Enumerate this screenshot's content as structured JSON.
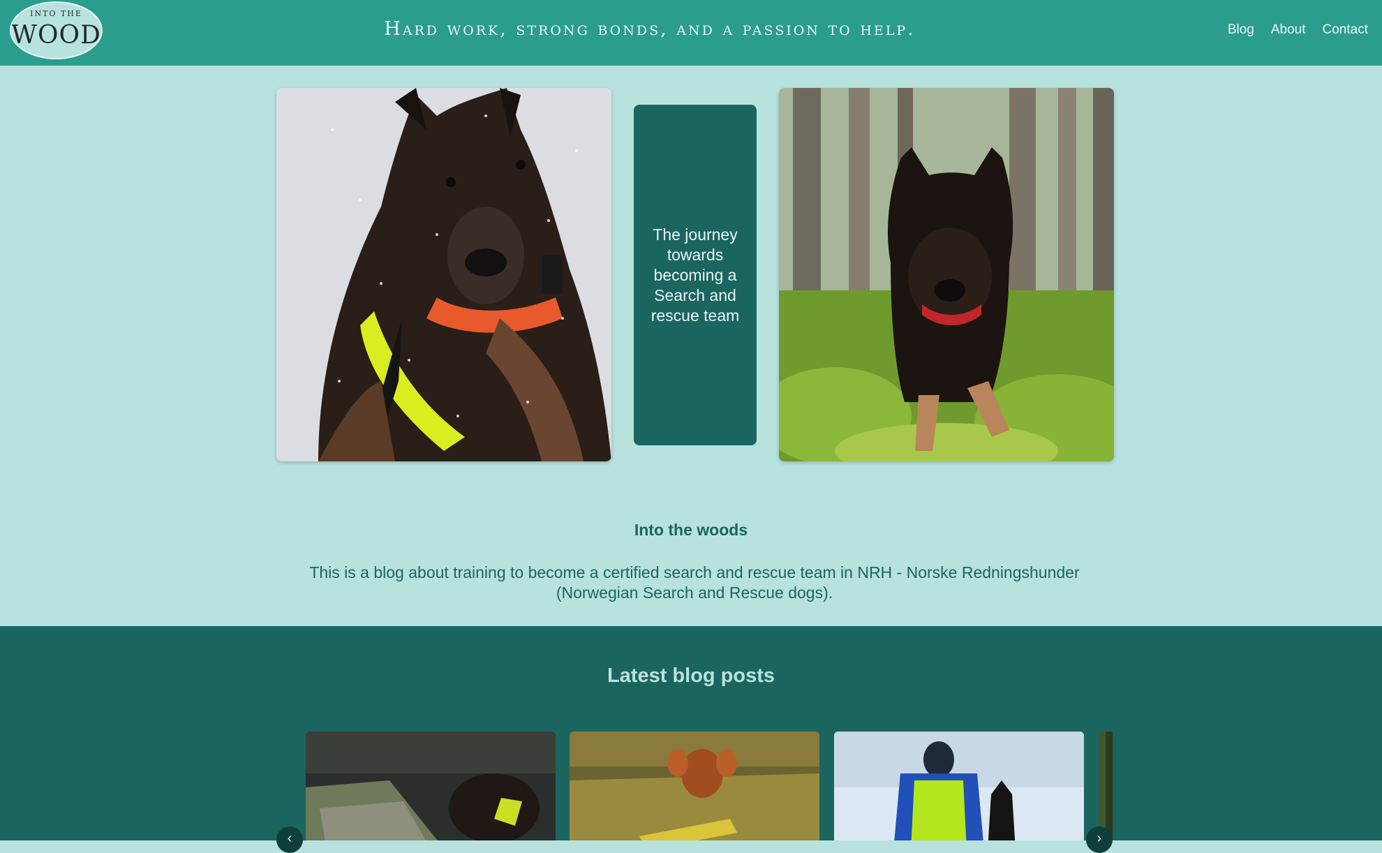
{
  "header": {
    "logo_text_small": "INTO THE",
    "logo_text_big": "WOODS",
    "tagline": "Hard work, strong bonds, and a passion to help.",
    "nav": [
      "Blog",
      "About",
      "Contact"
    ]
  },
  "hero": {
    "card_text": "The journey towards becoming a Search and rescue team"
  },
  "intro": {
    "title": "Into the woods",
    "text": "This is a blog about training to become a certified search and rescue team in NRH - Norske Redningshunder (Norwegian Search and Rescue dogs)."
  },
  "latest": {
    "title": "Latest blog posts",
    "prev_arrow": "‹",
    "next_arrow": "›"
  },
  "colors": {
    "header_bg": "#2a9d8f",
    "page_bg": "#b8e2de",
    "dark_teal": "#1b6560"
  }
}
